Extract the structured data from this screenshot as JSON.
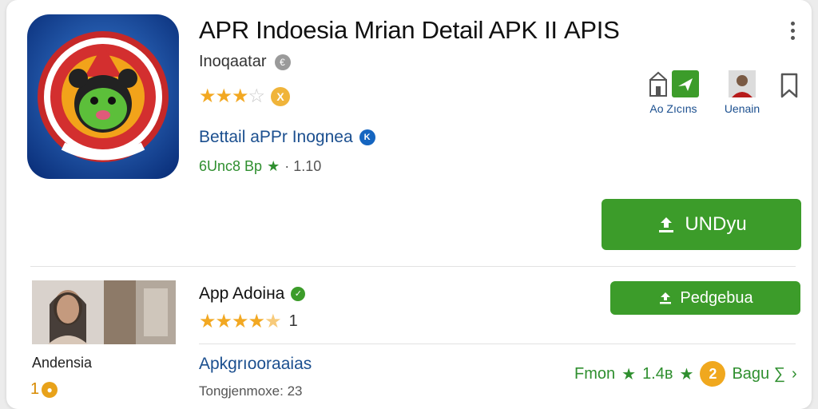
{
  "app": {
    "title": "APR Indoesia Mrian Detail APK IΙ APIS",
    "developer": "Inoqaatar",
    "developer_badge": "€",
    "rating_badge": "X",
    "link_text": "Bettail aPPr Inognea",
    "link_badge": "K",
    "meta_size": "6Unc8 Bp",
    "meta_version": "· 1.10"
  },
  "actions": [
    {
      "label": "Ao Zıcıns"
    },
    {
      "label": "Uenain"
    }
  ],
  "primary_button": {
    "label": "UNDyu"
  },
  "secondary_app": {
    "thumb_label": "Andensia",
    "thumb_rating": "1",
    "name": "App Adoiна",
    "rating_count": "1",
    "button_label": "Pedgebua",
    "link_text": "Apkgrıooraaias",
    "small_text": "Tongjenmoxe: 23",
    "footer_left": "Fmon",
    "footer_mid": "1.4в",
    "footer_badge": "2",
    "footer_right": "Bagu ∑"
  },
  "colors": {
    "accent_green": "#3c9c2a",
    "link_blue": "#1b4f8f",
    "star_orange": "#f2a822"
  }
}
